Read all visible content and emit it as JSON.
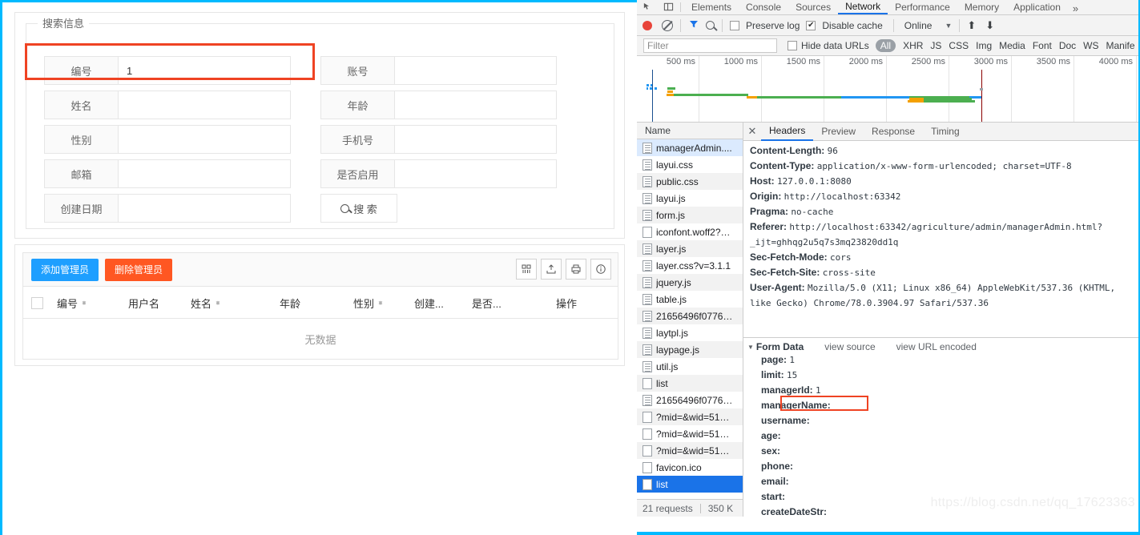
{
  "app": {
    "search_panel": {
      "legend": "搜索信息",
      "fields": [
        {
          "label": "编号",
          "value": "1",
          "highlighted": true
        },
        {
          "label": "账号",
          "value": ""
        },
        {
          "label": "姓名",
          "value": ""
        },
        {
          "label": "年龄",
          "value": ""
        },
        {
          "label": "性别",
          "value": ""
        },
        {
          "label": "手机号",
          "value": ""
        },
        {
          "label": "邮箱",
          "value": ""
        },
        {
          "label": "是否启用",
          "value": ""
        },
        {
          "label": "创建日期",
          "value": ""
        }
      ],
      "search_button": "搜 索"
    },
    "table_panel": {
      "add_button": "添加管理员",
      "delete_button": "删除管理员",
      "tool_icons": [
        "columns-icon",
        "export-icon",
        "print-icon",
        "info-icon"
      ],
      "columns": [
        {
          "label": "编号",
          "sortable": true
        },
        {
          "label": "用户名",
          "sortable": false
        },
        {
          "label": "姓名",
          "sortable": true
        },
        {
          "label": "年龄",
          "sortable": false
        },
        {
          "label": "性别",
          "sortable": true
        },
        {
          "label": "创建...",
          "sortable": false
        },
        {
          "label": "是否...",
          "sortable": false
        },
        {
          "label": "操作",
          "sortable": false
        }
      ],
      "empty_text": "无数据"
    }
  },
  "devtools": {
    "tabs": [
      {
        "label": "Elements",
        "active": false
      },
      {
        "label": "Console",
        "active": false
      },
      {
        "label": "Sources",
        "active": false
      },
      {
        "label": "Network",
        "active": true
      },
      {
        "label": "Performance",
        "active": false
      },
      {
        "label": "Memory",
        "active": false
      },
      {
        "label": "Application",
        "active": false
      }
    ],
    "more_tabs": "»",
    "controls": {
      "preserve_log": {
        "label": "Preserve log",
        "checked": false
      },
      "disable_cache": {
        "label": "Disable cache",
        "checked": true,
        "mark": "✔"
      },
      "throttle": "Online"
    },
    "filter": {
      "placeholder": "Filter",
      "value": "",
      "hide_data_urls": {
        "label": "Hide data URLs",
        "checked": false
      },
      "resource_types": [
        "All",
        "XHR",
        "JS",
        "CSS",
        "Img",
        "Media",
        "Font",
        "Doc",
        "WS",
        "Manife"
      ],
      "selected_type": "All"
    },
    "overview": {
      "ticks": [
        "500 ms",
        "1000 ms",
        "1500 ms",
        "2000 ms",
        "2500 ms",
        "3000 ms",
        "3500 ms",
        "4000 ms"
      ]
    },
    "requests": {
      "column_header": "Name",
      "items": [
        {
          "name": "managerAdmin....",
          "icon": "doc-lined",
          "state": "selected-light"
        },
        {
          "name": "layui.css",
          "icon": "doc-lined",
          "state": ""
        },
        {
          "name": "public.css",
          "icon": "doc-lined",
          "state": ""
        },
        {
          "name": "layui.js",
          "icon": "doc-lined",
          "state": ""
        },
        {
          "name": "form.js",
          "icon": "doc-lined",
          "state": ""
        },
        {
          "name": "iconfont.woff2?…",
          "icon": "doc-blank",
          "state": ""
        },
        {
          "name": "layer.js",
          "icon": "doc-lined",
          "state": ""
        },
        {
          "name": "layer.css?v=3.1.1",
          "icon": "doc-lined",
          "state": ""
        },
        {
          "name": "jquery.js",
          "icon": "doc-lined",
          "state": ""
        },
        {
          "name": "table.js",
          "icon": "doc-lined",
          "state": ""
        },
        {
          "name": "21656496f0776…",
          "icon": "doc-lined",
          "state": ""
        },
        {
          "name": "laytpl.js",
          "icon": "doc-lined",
          "state": ""
        },
        {
          "name": "laypage.js",
          "icon": "doc-lined",
          "state": ""
        },
        {
          "name": "util.js",
          "icon": "doc-lined",
          "state": ""
        },
        {
          "name": "list",
          "icon": "doc-blank",
          "state": ""
        },
        {
          "name": "21656496f0776…",
          "icon": "doc-lined",
          "state": ""
        },
        {
          "name": "?mid=&wid=51…",
          "icon": "doc-blank",
          "state": ""
        },
        {
          "name": "?mid=&wid=51…",
          "icon": "doc-blank",
          "state": ""
        },
        {
          "name": "?mid=&wid=51…",
          "icon": "doc-blank",
          "state": ""
        },
        {
          "name": "favicon.ico",
          "icon": "doc-blank",
          "state": ""
        },
        {
          "name": "list",
          "icon": "doc-blank",
          "state": "selected-blue"
        }
      ],
      "status": {
        "count": "21 requests",
        "size": "350 K"
      }
    },
    "detail": {
      "tabs": [
        {
          "label": "Headers",
          "active": true
        },
        {
          "label": "Preview",
          "active": false
        },
        {
          "label": "Response",
          "active": false
        },
        {
          "label": "Timing",
          "active": false
        }
      ],
      "headers": [
        {
          "key": "Content-Length:",
          "value": "96"
        },
        {
          "key": "Content-Type:",
          "value": "application/x-www-form-urlencoded; charset=UTF-8"
        },
        {
          "key": "Host:",
          "value": "127.0.0.1:8080"
        },
        {
          "key": "Origin:",
          "value": "http://localhost:63342"
        },
        {
          "key": "Pragma:",
          "value": "no-cache"
        },
        {
          "key": "Referer:",
          "value": "http://localhost:63342/agriculture/admin/managerAdmin.html?_ijt=ghhqg2u5q7s3mq23820dd1q",
          "wrap": true
        },
        {
          "key": "Sec-Fetch-Mode:",
          "value": "cors"
        },
        {
          "key": "Sec-Fetch-Site:",
          "value": "cross-site"
        },
        {
          "key": "User-Agent:",
          "value": "Mozilla/5.0 (X11; Linux x86_64) AppleWebKit/537.36 (KHTML, like Gecko) Chrome/78.0.3904.97 Safari/537.36",
          "wrap": true
        }
      ],
      "form_data": {
        "title": "Form Data",
        "view_source": "view source",
        "view_url_encoded": "view URL encoded",
        "rows": [
          {
            "key": "page:",
            "value": "1",
            "highlighted": false
          },
          {
            "key": "limit:",
            "value": "15",
            "highlighted": false
          },
          {
            "key": "managerId:",
            "value": "1",
            "highlighted": true
          },
          {
            "key": "managerName:",
            "value": "",
            "highlighted": false
          },
          {
            "key": "username:",
            "value": "",
            "highlighted": false
          },
          {
            "key": "age:",
            "value": "",
            "highlighted": false
          },
          {
            "key": "sex:",
            "value": "",
            "highlighted": false
          },
          {
            "key": "phone:",
            "value": "",
            "highlighted": false
          },
          {
            "key": "email:",
            "value": "",
            "highlighted": false
          },
          {
            "key": "start:",
            "value": "",
            "highlighted": false
          },
          {
            "key": "createDateStr:",
            "value": "",
            "highlighted": false
          }
        ]
      }
    },
    "watermark": "https://blog.csdn.net/qq_17623363"
  },
  "colors": {
    "accent_blue": "#00baff",
    "highlight_red": "#ef4323",
    "btn_blue": "#1e9fff",
    "btn_red": "#ff5722",
    "devtools_selected": "#1a73e8"
  }
}
